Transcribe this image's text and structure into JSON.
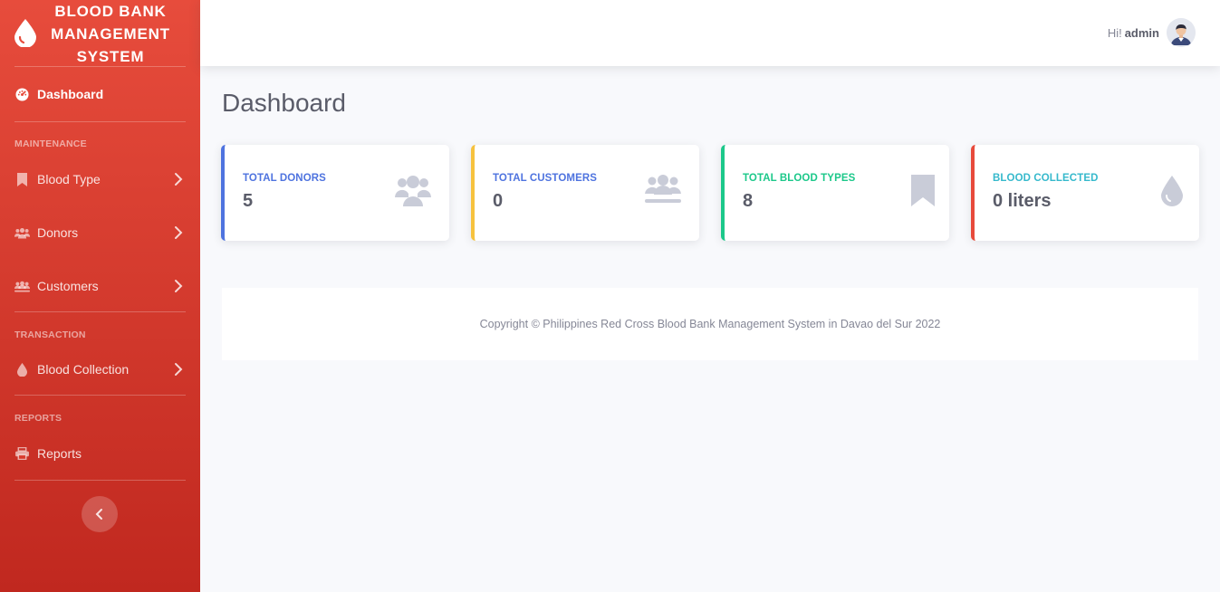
{
  "brand": {
    "title": "BLOOD BANK MANAGEMENT SYSTEM",
    "icon": "blood-drop-icon"
  },
  "sidebar": {
    "dashboard": {
      "label": "Dashboard",
      "icon": "dashboard-icon"
    },
    "headings": {
      "maintenance": "MAINTENANCE",
      "transaction": "TRANSACTION",
      "reports": "REPORTS"
    },
    "items": [
      {
        "label": "Blood Type",
        "icon": "bookmark-icon"
      },
      {
        "label": "Donors",
        "icon": "users-icon"
      },
      {
        "label": "Customers",
        "icon": "users-icon"
      },
      {
        "label": "Blood Collection",
        "icon": "blood-drop-icon"
      },
      {
        "label": "Reports",
        "icon": "printer-icon"
      }
    ]
  },
  "topbar": {
    "greeting": "Hi!",
    "username": "admin"
  },
  "main": {
    "title": "Dashboard"
  },
  "cards": [
    {
      "label": "TOTAL DONORS",
      "value": "5",
      "accent": "#4e73df",
      "icon": "users-icon"
    },
    {
      "label": "TOTAL CUSTOMERS",
      "value": "0",
      "accent": "#f6c23e",
      "icon": "users-icon"
    },
    {
      "label": "TOTAL BLOOD TYPES",
      "value": "8",
      "accent": "#1cc88a",
      "icon": "bookmark-icon"
    },
    {
      "label": "BLOOD COLLECTED",
      "value": "0 liters",
      "accent": "#e74a3b",
      "icon": "blood-drop-icon"
    }
  ],
  "footer": {
    "copyright": "Copyright © Philippines Red Cross Blood Bank Management System in Davao del Sur 2022"
  },
  "colors": {
    "sidebar_top": "#e74c3c",
    "sidebar_bottom": "#c0281f",
    "card_icon": "#c9ccd8"
  }
}
